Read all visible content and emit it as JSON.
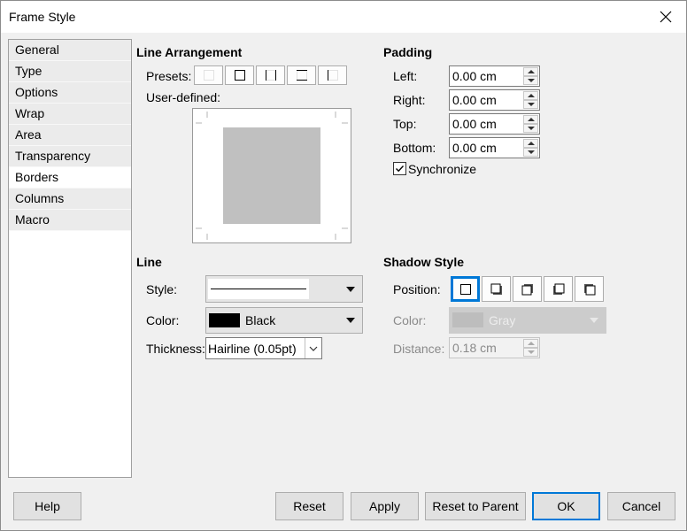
{
  "window": {
    "title": "Frame Style"
  },
  "sidebar": {
    "items": [
      {
        "label": "General"
      },
      {
        "label": "Type"
      },
      {
        "label": "Options"
      },
      {
        "label": "Wrap"
      },
      {
        "label": "Area"
      },
      {
        "label": "Transparency"
      },
      {
        "label": "Borders"
      },
      {
        "label": "Columns"
      },
      {
        "label": "Macro"
      }
    ],
    "active": "Borders"
  },
  "line_arrangement": {
    "title": "Line Arrangement",
    "presets_label": "Presets:",
    "user_defined_label": "User-defined:"
  },
  "padding": {
    "title": "Padding",
    "left_label": "Left:",
    "left_value": "0.00 cm",
    "right_label": "Right:",
    "right_value": "0.00 cm",
    "top_label": "Top:",
    "top_value": "0.00 cm",
    "bottom_label": "Bottom:",
    "bottom_value": "0.00 cm",
    "synchronize_label": "Synchronize",
    "synchronize_checked": true
  },
  "line": {
    "title": "Line",
    "style_label": "Style:",
    "color_label": "Color:",
    "color_value": "Black",
    "color_hex": "#000000",
    "thickness_label": "Thickness:",
    "thickness_value": "Hairline (0.05pt)"
  },
  "shadow": {
    "title": "Shadow Style",
    "position_label": "Position:",
    "color_label": "Color:",
    "color_value": "Gray",
    "color_hex": "#bdbdbd",
    "distance_label": "Distance:",
    "distance_value": "0.18 cm"
  },
  "buttons": {
    "help": "Help",
    "reset": "Reset",
    "apply": "Apply",
    "reset_to_parent": "Reset to Parent",
    "ok": "OK",
    "cancel": "Cancel"
  },
  "colors": {
    "accent": "#0078d7"
  }
}
